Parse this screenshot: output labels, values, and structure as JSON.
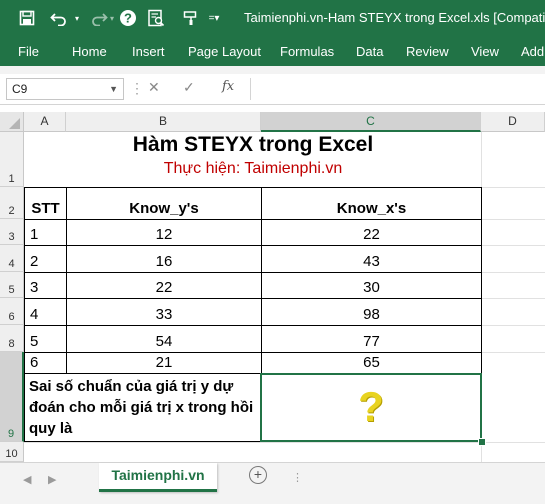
{
  "window": {
    "title": "Taimienphi.vn-Ham STEYX trong Excel.xls  [Compatibility",
    "quick_access": [
      "save-icon",
      "undo-icon",
      "redo-icon",
      "help-icon",
      "print-preview-icon",
      "customize-icon"
    ]
  },
  "ribbon": {
    "tabs": [
      "File",
      "Home",
      "Insert",
      "Page Layout",
      "Formulas",
      "Data",
      "Review",
      "View",
      "Add"
    ]
  },
  "formula_bar": {
    "name_box": "C9",
    "fx_label": "fx",
    "content": ""
  },
  "grid": {
    "columns": [
      "A",
      "B",
      "C",
      "D"
    ],
    "selected_column": "C",
    "rows": [
      "1",
      "2",
      "3",
      "4",
      "5",
      "6",
      "8",
      "9",
      "10"
    ],
    "selected_row": "9"
  },
  "sheet": {
    "title": "Hàm STEYX trong Excel",
    "subtitle": "Thực hiện: Taimienphi.vn",
    "headers": [
      "STT",
      "Know_y's",
      "Know_x's"
    ],
    "rows": [
      [
        "1",
        "12",
        "22"
      ],
      [
        "2",
        "16",
        "43"
      ],
      [
        "3",
        "22",
        "30"
      ],
      [
        "4",
        "33",
        "98"
      ],
      [
        "5",
        "54",
        "77"
      ],
      [
        "6",
        "21",
        "65"
      ]
    ],
    "note": "Sai số chuẩn của giá trị y dự đoán cho mỗi giá trị x trong hồi quy là",
    "answer": "?"
  },
  "tabs_bar": {
    "sheet_tab": "Taimienphi.vn",
    "add_label": "+"
  },
  "colors": {
    "excel_green": "#217346",
    "subtitle_red": "#c00000",
    "question_yellow": "#e8d320"
  }
}
